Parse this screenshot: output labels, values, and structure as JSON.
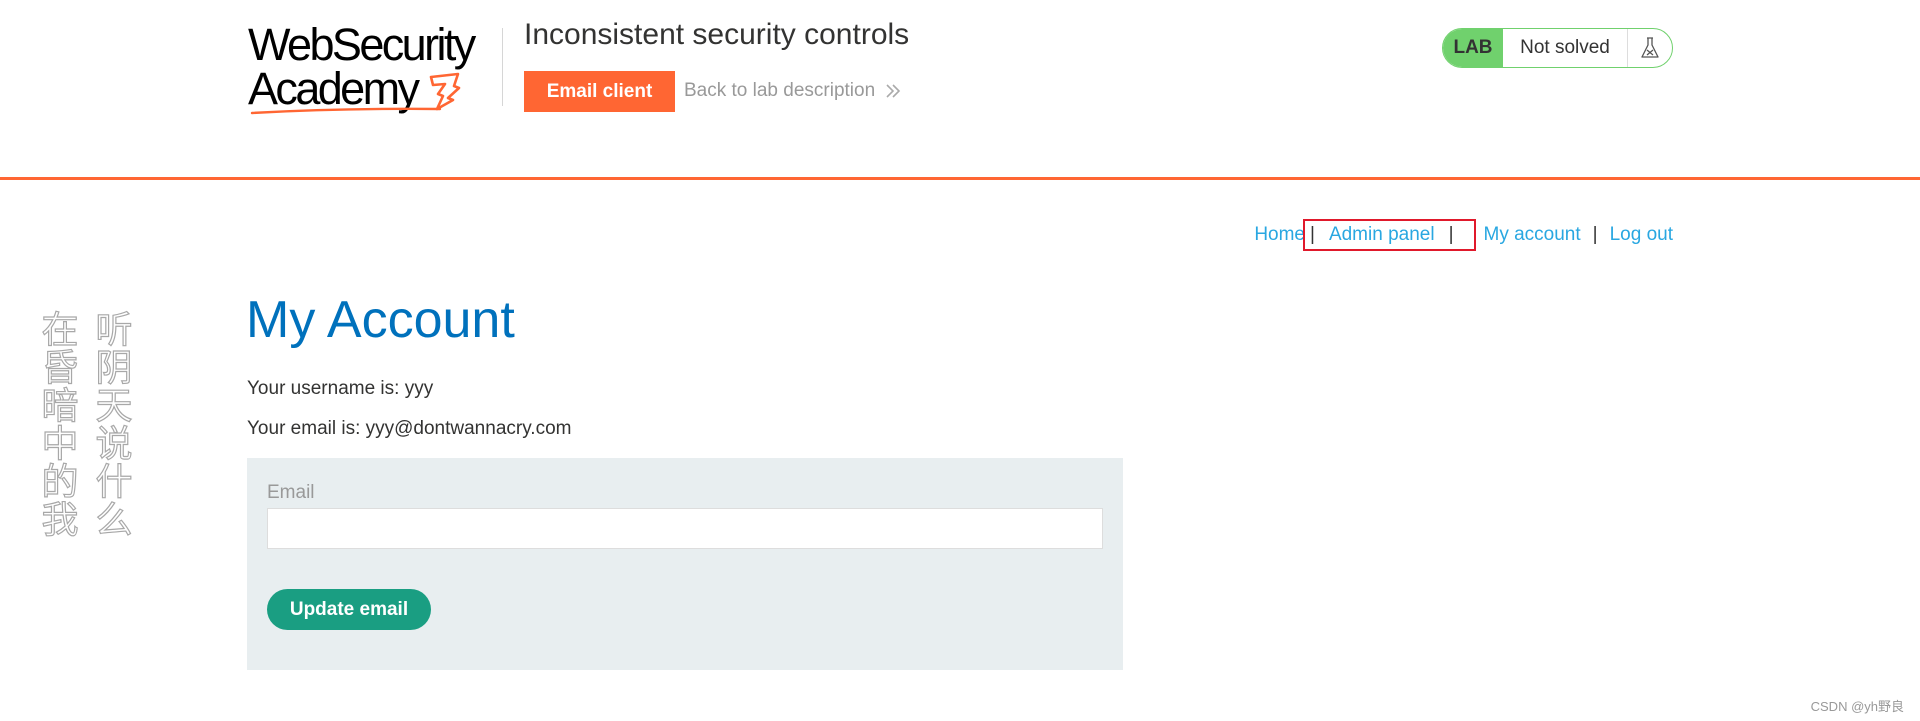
{
  "header": {
    "logo": {
      "line1": "WebSecurity",
      "line2": "Academy"
    },
    "lab_title": "Inconsistent security controls",
    "email_client_label": "Email client",
    "back_link_label": "Back to lab description",
    "status": {
      "badge": "LAB",
      "state": "Not solved",
      "icon": "flask-icon"
    }
  },
  "nav": {
    "items": [
      {
        "label": "Home"
      },
      {
        "label": "Admin panel"
      },
      {
        "label": "My account"
      },
      {
        "label": "Log out"
      }
    ],
    "separator": "|"
  },
  "watermark": {
    "col1": "在昏暗中的我",
    "col2": "听阴天说什么"
  },
  "main": {
    "title": "My Account",
    "username_line": "Your username is: yyy",
    "email_line": "Your email is: yyy@dontwannacry.com",
    "form": {
      "email_label": "Email",
      "email_value": "",
      "update_label": "Update email"
    }
  },
  "footer": {
    "credit": "CSDN @yh野良"
  },
  "colors": {
    "accent_orange": "#ff6633",
    "link_blue": "#29a7e1",
    "title_blue": "#0071bc",
    "status_green": "#70d16d",
    "button_teal": "#1a9e82",
    "highlight_red": "#e0192b"
  }
}
